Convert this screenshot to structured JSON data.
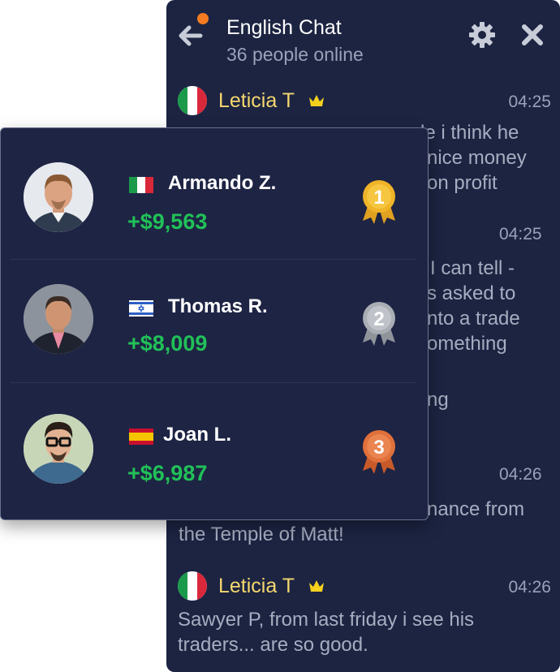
{
  "chat": {
    "title": "English Chat",
    "online": "36 people online",
    "messages": [
      {
        "name": "Leticia T",
        "time": "04:25",
        "text": ""
      },
      {
        "name": "Leticia T",
        "time": "04:26",
        "text": "Sawyer P, from last friday i see his traders... are so good."
      }
    ],
    "fragments": {
      "f1": "le i think he",
      "f2": "nice money",
      "f3": "on profit",
      "t2": "04:25",
      "f4": "I can tell -",
      "f5": "s asked to",
      "f6": "nto a trade",
      "f7": "omething",
      "f8": "ng",
      "t3": "04:26",
      "f9": "nance from",
      "f10": "the Temple of Matt!"
    }
  },
  "leaderboard": [
    {
      "name": "Armando Z.",
      "amount": "+$9,563",
      "rank": "1",
      "country": "Italy"
    },
    {
      "name": "Thomas R.",
      "amount": "+$8,009",
      "rank": "2",
      "country": "Israel"
    },
    {
      "name": "Joan L.",
      "amount": "+$6,987",
      "rank": "3",
      "country": "Spain"
    }
  ],
  "colors": {
    "panel_bg": "#1c2442",
    "accent_orange": "#f47b20",
    "name_gold": "#f5d76e",
    "profit_green": "#21c158",
    "gold_medal": "#f0b428",
    "silver_medal": "#a9adb4",
    "bronze_medal": "#e0703a"
  },
  "icons": [
    "back-arrow-icon",
    "gear-icon",
    "close-icon",
    "crown-icon",
    "medal-icon"
  ]
}
